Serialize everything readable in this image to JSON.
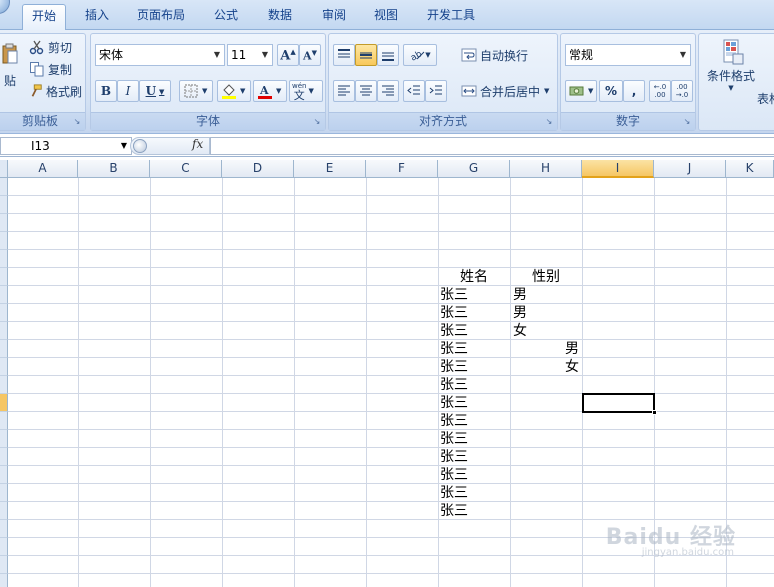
{
  "tabs": [
    "开始",
    "插入",
    "页面布局",
    "公式",
    "数据",
    "审阅",
    "视图",
    "开发工具"
  ],
  "clipboard": {
    "paste": "贴",
    "cut": "剪切",
    "copy": "复制",
    "format_painter": "格式刷",
    "label": "剪贴板"
  },
  "font": {
    "name": "宋体",
    "size": "11",
    "label": "字体",
    "bold": "B",
    "italic": "I",
    "underline": "U",
    "phonetic": "wén",
    "phonetic_char": "文"
  },
  "alignment": {
    "wrap": "自动换行",
    "merge": "合并后居中",
    "label": "对齐方式"
  },
  "number": {
    "format": "常规",
    "label": "数字",
    "percent": "%",
    "comma": ",",
    "inc_decimal": "←.0 .00",
    "dec_decimal": ".00 →.0"
  },
  "styles": {
    "conditional": "条件格式",
    "table": "表格"
  },
  "formula_bar": {
    "name_box": "I13",
    "fx": "fx",
    "content": ""
  },
  "columns": [
    "A",
    "B",
    "C",
    "D",
    "E",
    "F",
    "G",
    "H",
    "I",
    "J",
    "K"
  ],
  "selected_column": "I",
  "selected_cell": "I13",
  "cells": [
    {
      "ref": "G7",
      "value": "姓名"
    },
    {
      "ref": "H7",
      "value": "性别"
    },
    {
      "ref": "G8",
      "value": "张三"
    },
    {
      "ref": "H8",
      "value": "男"
    },
    {
      "ref": "G9",
      "value": "张三"
    },
    {
      "ref": "H9",
      "value": "男"
    },
    {
      "ref": "G10",
      "value": "张三"
    },
    {
      "ref": "H10",
      "value": "女"
    },
    {
      "ref": "G11",
      "value": "张三"
    },
    {
      "ref": "H11",
      "value": "男"
    },
    {
      "ref": "G12",
      "value": "张三"
    },
    {
      "ref": "H12",
      "value": "女"
    },
    {
      "ref": "G13",
      "value": "张三"
    },
    {
      "ref": "G14",
      "value": "张三"
    },
    {
      "ref": "G15",
      "value": "张三"
    },
    {
      "ref": "G16",
      "value": "张三"
    },
    {
      "ref": "G17",
      "value": "张三"
    },
    {
      "ref": "G18",
      "value": "张三"
    },
    {
      "ref": "G19",
      "value": "张三"
    },
    {
      "ref": "G20",
      "value": "张三"
    }
  ],
  "watermark": {
    "brand": "Baidu 经验",
    "url": "jingyan.baidu.com"
  }
}
